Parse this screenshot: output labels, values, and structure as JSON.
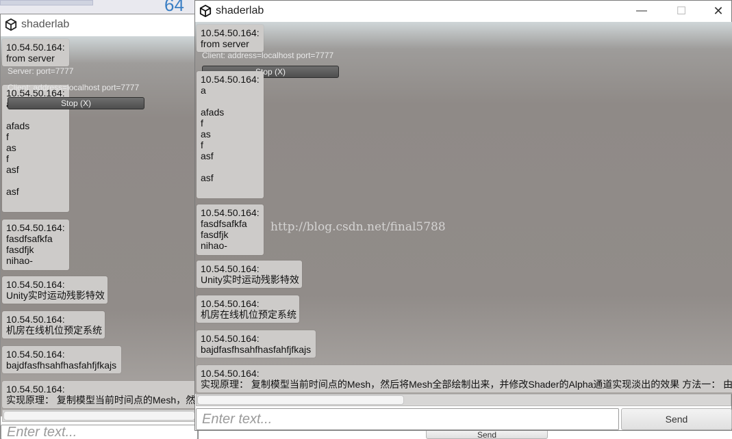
{
  "background": {
    "number_text": "64"
  },
  "back_window": {
    "title": "shaderlab",
    "server_label": "Server: port=7777",
    "client_label": "Client: address=localhost port=7777",
    "stop_button": "Stop (X)",
    "messages": [
      "10.54.50.164:\nfrom server",
      "10.54.50.164:\na\n\nafads\nf\nas\nf\nasf\n\nasf",
      "10.54.50.164:\nfasdfsafkfa\nfasdfjk\nnihao-",
      "10.54.50.164:\nUnity实时运动残影特效",
      "10.54.50.164:\n机房在线机位预定系统",
      "10.54.50.164:\nbajdfasfhsahfhasfahfjfkajs",
      "10.54.50.164:\n实现原理： 复制模型当前时间点的Mesh，然"
    ],
    "input_placeholder": "Enter text...",
    "send_button": "Send"
  },
  "front_window": {
    "title": "shaderlab",
    "controls": {
      "minimize": "—",
      "maximize": "☐",
      "close": "✕"
    },
    "client_label": "Client: address=localhost port=7777",
    "stop_button": "Stop (X)",
    "messages": [
      "10.54.50.164:\nfrom server",
      "10.54.50.164:\na\n\nafads\nf\nas\nf\nasf\n\nasf",
      "10.54.50.164:\nfasdfsafkfa\nfasdfjk\nnihao-",
      "10.54.50.164:\nUnity实时运动残影特效",
      "10.54.50.164:\n机房在线机位预定系统",
      "10.54.50.164:\nbajdfasfhsahfhasfahfjfkajs",
      "10.54.50.164:\n实现原理： 复制模型当前时间点的Mesh，然后将Mesh全部绘制出来，并修改Shader的Alpha通道实现淡出的效果 方法一： 由"
    ],
    "input_placeholder": "Enter text...",
    "send_button": "Send"
  },
  "watermark": "http://blog.csdn.net/final5788",
  "icons": {
    "app": "unity-logo-icon"
  },
  "colors": {
    "message_bubble": "#cdcbc9",
    "overlay_text": "#e9e9e9"
  }
}
